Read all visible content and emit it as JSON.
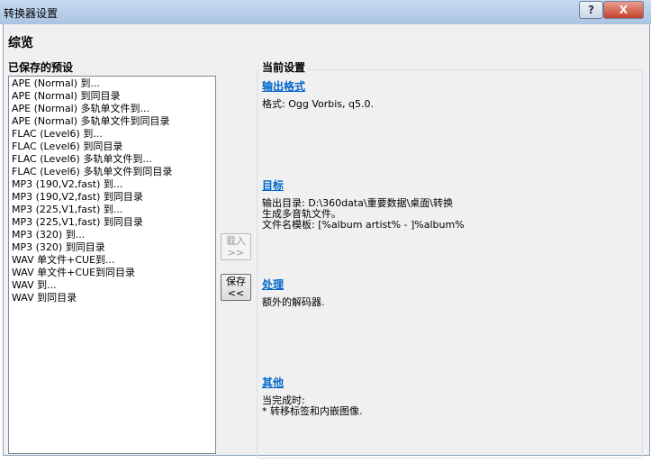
{
  "window": {
    "title": "转换器设置",
    "help_label": "?",
    "close_label": "X"
  },
  "overview_title": "综览",
  "presets": {
    "label": "已保存的预设",
    "items": [
      "APE (Normal) 到...",
      "APE (Normal) 到同目录",
      "APE (Normal) 多轨单文件到...",
      "APE (Normal) 多轨单文件到同目录",
      "FLAC (Level6) 到...",
      "FLAC (Level6) 到同目录",
      "FLAC (Level6) 多轨单文件到...",
      "FLAC (Level6) 多轨单文件到同目录",
      "MP3 (190,V2,fast) 到...",
      "MP3 (190,V2,fast) 到同目录",
      "MP3 (225,V1,fast) 到...",
      "MP3 (225,V1,fast) 到同目录",
      "MP3 (320) 到...",
      "MP3 (320) 到同目录",
      "WAV 单文件+CUE到...",
      "WAV 单文件+CUE到同目录",
      "WAV 到...",
      "WAV 到同目录"
    ]
  },
  "buttons": {
    "load": "载入",
    "load_arrow": ">>",
    "save": "保存",
    "save_arrow": "<<"
  },
  "current": {
    "label": "当前设置",
    "output_format": {
      "title": "输出格式",
      "lines": [
        "格式: Ogg Vorbis, q5.0."
      ]
    },
    "destination": {
      "title": "目标",
      "lines": [
        "输出目录: D:\\360data\\重要数据\\桌面\\转换",
        "生成多音轨文件。",
        "文件名模板: [%album artist% - ]%album%"
      ]
    },
    "processing": {
      "title": "处理",
      "lines": [
        "额外的解码器."
      ]
    },
    "other": {
      "title": "其他",
      "lines": [
        "当完成时:",
        "* 转移标签和内嵌图像."
      ]
    }
  }
}
